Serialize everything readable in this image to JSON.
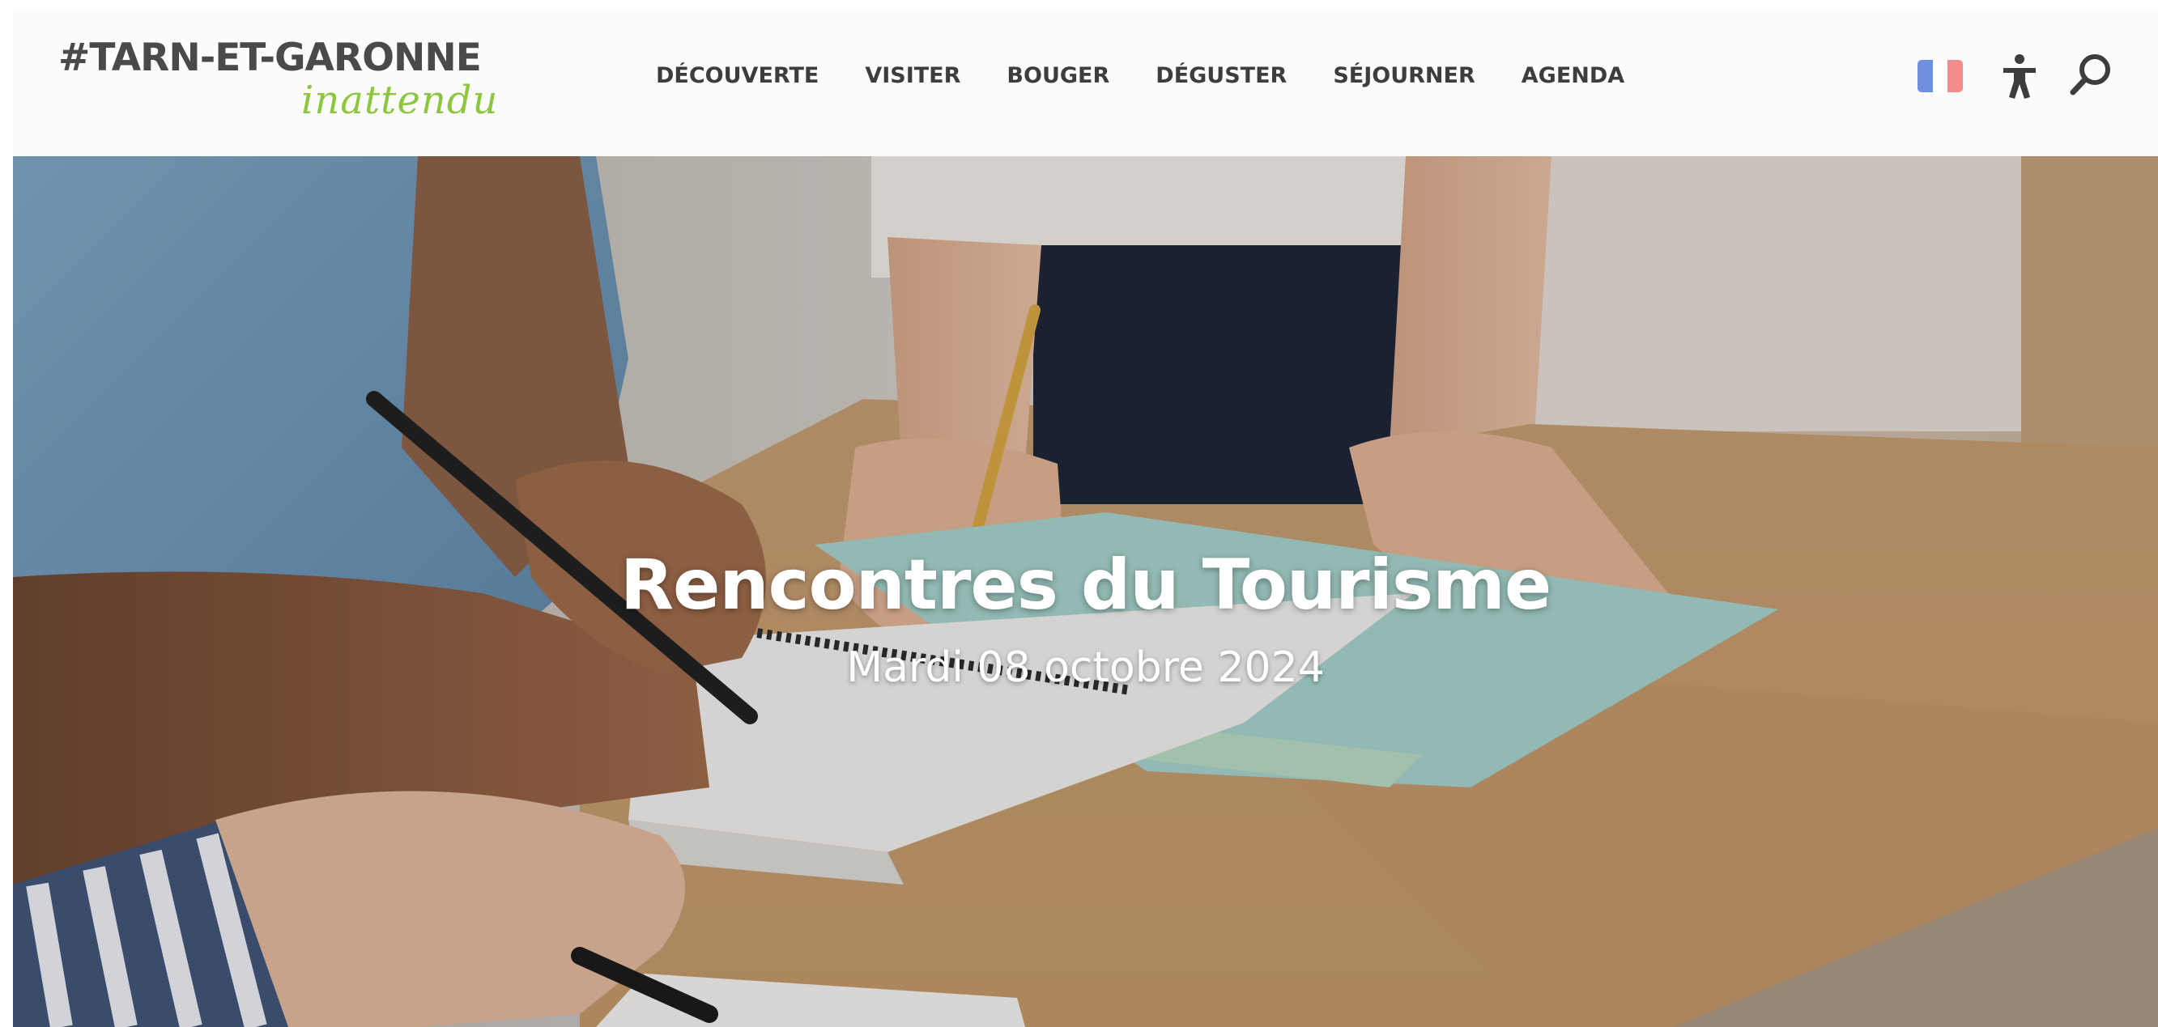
{
  "header": {
    "logo": {
      "main": "#TARN-ET-GARONNE",
      "sub": "inattendu"
    },
    "nav": [
      {
        "label": "DÉCOUVERTE"
      },
      {
        "label": "VISITER"
      },
      {
        "label": "BOUGER"
      },
      {
        "label": "DÉGUSTER"
      },
      {
        "label": "SÉJOURNER"
      },
      {
        "label": "AGENDA"
      }
    ],
    "icons": {
      "language": "french-flag-icon",
      "accessibility": "accessibility-icon",
      "search": "search-icon"
    }
  },
  "hero": {
    "title": "Rencontres du Tourisme",
    "date": "Mardi 08 octobre 2024"
  },
  "colors": {
    "logo_text": "#4a4a4a",
    "logo_accent": "#8dc63f",
    "nav_text": "#3d3d3d",
    "flag_blue": "#6f8fe0",
    "flag_white": "#ffffff",
    "flag_red": "#f58c8c",
    "hero_text": "#ffffff"
  }
}
